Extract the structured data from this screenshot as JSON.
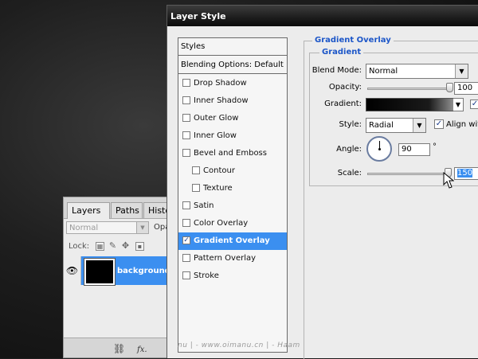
{
  "layers_panel": {
    "tabs": [
      "Layers",
      "Paths",
      "Histo"
    ],
    "tab_close_glyph": "×",
    "blend_mode": "Normal",
    "opacity_label": "Opa",
    "lock_label": "Lock:",
    "layer_name": "background",
    "footer_icons": [
      "link-icon",
      "fx-icon"
    ]
  },
  "dialog": {
    "title": "Layer Style",
    "styles_header": "Styles",
    "blending_options": "Blending Options: Default",
    "style_items": [
      {
        "label": "Drop Shadow",
        "checked": false,
        "indent": false,
        "selected": false
      },
      {
        "label": "Inner Shadow",
        "checked": false,
        "indent": false,
        "selected": false
      },
      {
        "label": "Outer Glow",
        "checked": false,
        "indent": false,
        "selected": false
      },
      {
        "label": "Inner Glow",
        "checked": false,
        "indent": false,
        "selected": false
      },
      {
        "label": "Bevel and Emboss",
        "checked": false,
        "indent": false,
        "selected": false
      },
      {
        "label": "Contour",
        "checked": false,
        "indent": true,
        "selected": false
      },
      {
        "label": "Texture",
        "checked": false,
        "indent": true,
        "selected": false
      },
      {
        "label": "Satin",
        "checked": false,
        "indent": false,
        "selected": false
      },
      {
        "label": "Color Overlay",
        "checked": false,
        "indent": false,
        "selected": false
      },
      {
        "label": "Gradient Overlay",
        "checked": true,
        "indent": false,
        "selected": true
      },
      {
        "label": "Pattern Overlay",
        "checked": false,
        "indent": false,
        "selected": false
      },
      {
        "label": "Stroke",
        "checked": false,
        "indent": false,
        "selected": false
      }
    ],
    "gradient_overlay": {
      "group_title": "Gradient Overlay",
      "subgroup_title": "Gradient",
      "blend_mode_label": "Blend Mode:",
      "blend_mode_value": "Normal",
      "opacity_label": "Opacity:",
      "opacity_value": "100",
      "opacity_fraction": 1.0,
      "gradient_label": "Gradient:",
      "reverse_checked": true,
      "style_label": "Style:",
      "style_value": "Radial",
      "align_label": "Align with",
      "align_checked": true,
      "angle_label": "Angle:",
      "angle_value": "90",
      "angle_unit": "°",
      "scale_label": "Scale:",
      "scale_value": "150",
      "scale_fraction": 0.98
    },
    "watermark": "nu | - www.oimanu.cn | - Haam"
  },
  "colors": {
    "selection_blue": "#3b8ff0",
    "group_title_blue": "#1c56c8",
    "title_bar": "#1c1c1c"
  }
}
